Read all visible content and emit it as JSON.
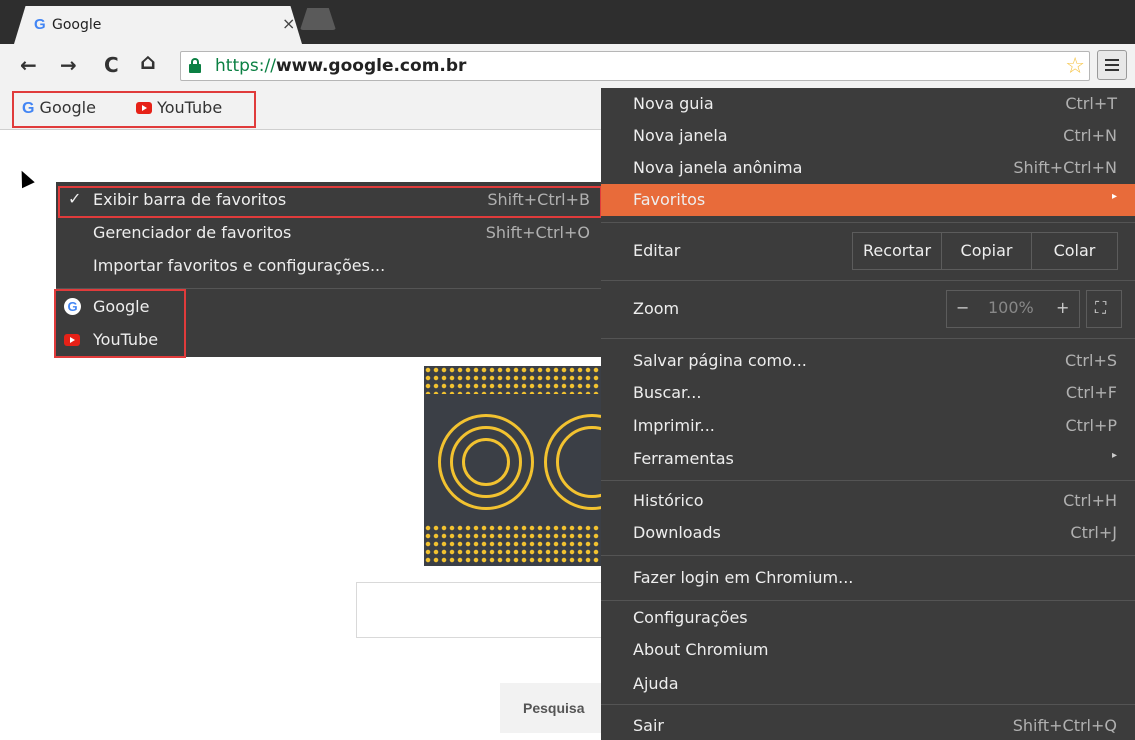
{
  "tab": {
    "title": "Google",
    "favicon": "G",
    "close": "×"
  },
  "toolbar": {
    "back": "←",
    "forward": "→",
    "reload": "C",
    "home": "⌂",
    "url_scheme": "https://",
    "url_host": "www.google.com.br",
    "star": "☆"
  },
  "bookmarks_bar": {
    "items": [
      {
        "label": "Google"
      },
      {
        "label": "YouTube"
      }
    ]
  },
  "page": {
    "search_button": "Pesquisa"
  },
  "submenu": {
    "items": [
      {
        "label": "Exibir barra de favoritos",
        "shortcut": "Shift+Ctrl+B",
        "check": "✓"
      },
      {
        "label": "Gerenciador de favoritos",
        "shortcut": "Shift+Ctrl+O"
      },
      {
        "label": "Importar favoritos e configurações..."
      }
    ],
    "bookmarks": [
      {
        "label": "Google"
      },
      {
        "label": "YouTube"
      }
    ]
  },
  "menu": {
    "nova_guia": {
      "label": "Nova guia",
      "shortcut": "Ctrl+T"
    },
    "nova_janela": {
      "label": "Nova janela",
      "shortcut": "Ctrl+N"
    },
    "anonima": {
      "label": "Nova janela anônima",
      "shortcut": "Shift+Ctrl+N"
    },
    "favoritos": {
      "label": "Favoritos",
      "arrow": "▸"
    },
    "editar": {
      "label": "Editar",
      "recortar": "Recortar",
      "copiar": "Copiar",
      "colar": "Colar"
    },
    "zoom": {
      "label": "Zoom",
      "minus": "−",
      "value": "100%",
      "plus": "+",
      "fullscreen": "⛶"
    },
    "salvar": {
      "label": "Salvar página como...",
      "shortcut": "Ctrl+S"
    },
    "buscar": {
      "label": "Buscar...",
      "shortcut": "Ctrl+F"
    },
    "imprimir": {
      "label": "Imprimir...",
      "shortcut": "Ctrl+P"
    },
    "ferramentas": {
      "label": "Ferramentas",
      "arrow": "▸"
    },
    "historico": {
      "label": "Histórico",
      "shortcut": "Ctrl+H"
    },
    "downloads": {
      "label": "Downloads",
      "shortcut": "Ctrl+J"
    },
    "login": {
      "label": "Fazer login em Chromium..."
    },
    "configuracoes": {
      "label": "Configurações"
    },
    "about": {
      "label": "About Chromium"
    },
    "ajuda": {
      "label": "Ajuda"
    },
    "sair": {
      "label": "Sair",
      "shortcut": "Shift+Ctrl+Q"
    }
  },
  "colors": {
    "menu_bg": "#3c3c3c",
    "highlight": "#e86b3a",
    "annotation": "#e03b3b",
    "doodle_yellow": "#f2c230"
  }
}
